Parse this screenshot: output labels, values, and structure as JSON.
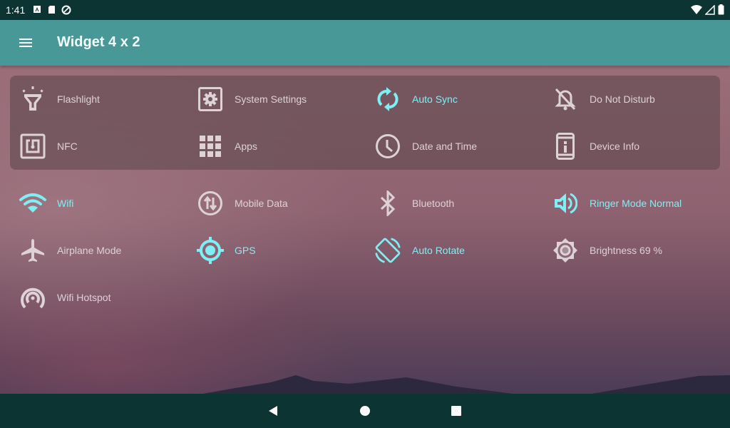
{
  "status_bar": {
    "time": "1:41",
    "left_icons": [
      "app-notification-icon",
      "sd-card-icon",
      "sync-disabled-icon"
    ],
    "right_icons": [
      "wifi-signal-icon",
      "cell-signal-icon",
      "battery-icon"
    ]
  },
  "app_bar": {
    "title": "Widget 4 x 2",
    "menu_icon": "hamburger-menu-icon"
  },
  "colors": {
    "active": "#7ef0f4",
    "inactive": "#ddd3d6",
    "app_bar": "#479896",
    "system_bar": "#0b3433"
  },
  "widget_card": {
    "tiles": [
      {
        "label": "Flashlight",
        "icon": "flashlight-icon",
        "active": false
      },
      {
        "label": "System Settings",
        "icon": "settings-icon",
        "active": false
      },
      {
        "label": "Auto Sync",
        "icon": "sync-icon",
        "active": true
      },
      {
        "label": "Do Not Disturb",
        "icon": "bell-off-icon",
        "active": false
      },
      {
        "label": "NFC",
        "icon": "nfc-icon",
        "active": false
      },
      {
        "label": "Apps",
        "icon": "apps-grid-icon",
        "active": false
      },
      {
        "label": "Date and Time",
        "icon": "clock-icon",
        "active": false
      },
      {
        "label": "Device Info",
        "icon": "device-info-icon",
        "active": false
      }
    ]
  },
  "toggles": {
    "tiles": [
      {
        "label": "Wifi",
        "icon": "wifi-icon",
        "active": true
      },
      {
        "label": "Mobile Data",
        "icon": "mobile-data-icon",
        "active": false
      },
      {
        "label": "Bluetooth",
        "icon": "bluetooth-icon",
        "active": false
      },
      {
        "label": "Ringer Mode Normal",
        "icon": "volume-icon",
        "active": true
      },
      {
        "label": "Airplane Mode",
        "icon": "airplane-icon",
        "active": false
      },
      {
        "label": "GPS",
        "icon": "gps-icon",
        "active": true
      },
      {
        "label": "Auto Rotate",
        "icon": "auto-rotate-icon",
        "active": true
      },
      {
        "label": "Brightness 69 %",
        "icon": "brightness-icon",
        "active": false
      },
      {
        "label": "Wifi Hotspot",
        "icon": "hotspot-icon",
        "active": false
      }
    ]
  },
  "nav_bar": {
    "buttons": [
      "back-icon",
      "home-icon",
      "recents-icon"
    ]
  }
}
